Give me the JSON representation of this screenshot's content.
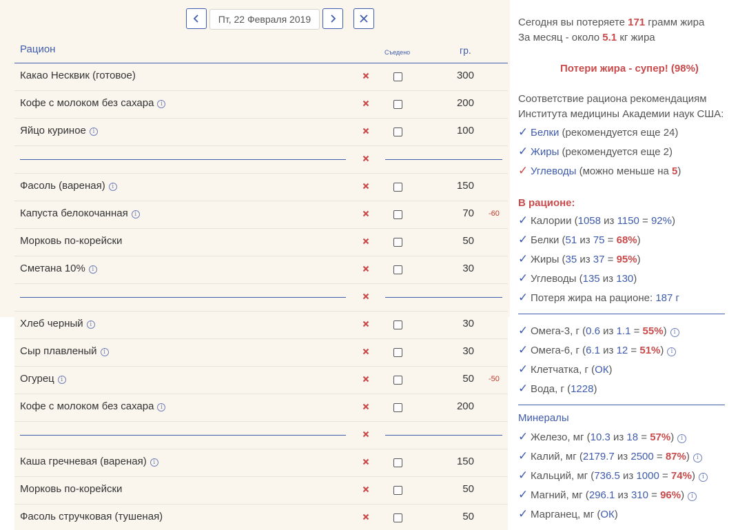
{
  "date_nav": {
    "date_text": "Пт, 22  Февраля 2019"
  },
  "table": {
    "title": "Рацион",
    "eaten_label": "Съедено",
    "unit_label": "гр.",
    "rows": [
      {
        "type": "item",
        "name": "Какао Несквик (готовое)",
        "info": false,
        "amount": "300",
        "diff": ""
      },
      {
        "type": "item",
        "name": "Кофе с молоком без сахара",
        "info": true,
        "amount": "200",
        "diff": ""
      },
      {
        "type": "item",
        "name": "Яйцо куриное",
        "info": true,
        "amount": "100",
        "diff": ""
      },
      {
        "type": "separator"
      },
      {
        "type": "item",
        "name": "Фасоль (вареная)",
        "info": true,
        "amount": "150",
        "diff": ""
      },
      {
        "type": "item",
        "name": "Капуста белокочанная",
        "info": true,
        "amount": "70",
        "diff": "-60"
      },
      {
        "type": "item",
        "name": "Морковь по-корейски",
        "info": false,
        "amount": "50",
        "diff": ""
      },
      {
        "type": "item",
        "name": "Сметана 10%",
        "info": true,
        "amount": "30",
        "diff": ""
      },
      {
        "type": "separator"
      },
      {
        "type": "item",
        "name": "Хлеб черный",
        "info": true,
        "amount": "30",
        "diff": ""
      },
      {
        "type": "item",
        "name": "Сыр плавленый",
        "info": true,
        "amount": "30",
        "diff": ""
      },
      {
        "type": "item",
        "name": "Огурец",
        "info": true,
        "amount": "50",
        "diff": "-50"
      },
      {
        "type": "item",
        "name": "Кофе с молоком без сахара",
        "info": true,
        "amount": "200",
        "diff": ""
      },
      {
        "type": "separator"
      },
      {
        "type": "item",
        "name": "Каша гречневая (вареная)",
        "info": true,
        "amount": "150",
        "diff": ""
      },
      {
        "type": "item",
        "name": "Морковь по-корейски",
        "info": false,
        "amount": "50",
        "diff": ""
      },
      {
        "type": "item",
        "name": "Фасоль стручковая (тушеная)",
        "info": false,
        "amount": "50",
        "diff": ""
      }
    ]
  },
  "summary": {
    "today_pre": "Сегодня вы потеряете ",
    "today_value": "171",
    "today_post": " грамм жира",
    "month_pre": "За месяц - около ",
    "month_value": "5.1",
    "month_post": " кг жира",
    "fat_loss_status": "Потери жира - супер! (98%)",
    "compliance_line1": "Соответствие рациона рекомендациям",
    "compliance_line2": "Института медицины Академии наук США:",
    "recommendations": [
      {
        "name": "Белки",
        "pre": " (рекомендуется еще ",
        "value": "24",
        "post": ")",
        "mark": "blue",
        "value_red": false
      },
      {
        "name": "Жиры",
        "pre": " (рекомендуется еще ",
        "value": "2",
        "post": ")",
        "mark": "blue",
        "value_red": false
      },
      {
        "name": "Углеводы",
        "pre": " (можно меньше на ",
        "value": "5",
        "post": ")",
        "mark": "red",
        "value_red": true
      }
    ],
    "in_diet_title": "В рационе:",
    "in_diet": [
      {
        "label": "Калории (",
        "a": "1058",
        "mid": " из ",
        "b": "1150",
        "eq": " = ",
        "pct": "92%",
        "pct_red": false,
        "end": ")"
      },
      {
        "label": "Белки (",
        "a": "51",
        "mid": " из ",
        "b": "75",
        "eq": " = ",
        "pct": "68%",
        "pct_red": true,
        "end": ")"
      },
      {
        "label": "Жиры (",
        "a": "35",
        "mid": " из ",
        "b": "37",
        "eq": " = ",
        "pct": "95%",
        "pct_red": true,
        "end": ")"
      },
      {
        "label": "Углеводы (",
        "a": "135",
        "mid": " из ",
        "b": "130",
        "eq": "",
        "pct": "",
        "pct_red": false,
        "end": ")"
      }
    ],
    "fat_loss_line_label": "Потеря жира на рационе: ",
    "fat_loss_line_value": "187 г",
    "omega": [
      {
        "label": "Омега-3, г (",
        "a": "0.6",
        "mid": " из ",
        "b": "1.1",
        "eq": " = ",
        "pct": "55%",
        "end": ")",
        "info": true
      },
      {
        "label": "Омега-6, г (",
        "a": "6.1",
        "mid": " из ",
        "b": "12",
        "eq": " = ",
        "pct": "51%",
        "end": ")",
        "info": true
      }
    ],
    "fiber_label": "Клетчатка, г (",
    "fiber_value": "ОК",
    "fiber_end": ")",
    "water_label": "Вода, г (",
    "water_value": "1228",
    "water_end": ")",
    "minerals_title": "Минералы",
    "minerals": [
      {
        "label": "Железо, мг (",
        "a": "10.3",
        "mid": " из ",
        "b": "18",
        "eq": " = ",
        "pct": "57%",
        "end": ")",
        "info": true
      },
      {
        "label": "Калий, мг (",
        "a": "2179.7",
        "mid": " из ",
        "b": "2500",
        "eq": " = ",
        "pct": "87%",
        "end": ")",
        "info": true
      },
      {
        "label": "Кальций, мг (",
        "a": "736.5",
        "mid": " из ",
        "b": "1000",
        "eq": " = ",
        "pct": "74%",
        "end": ")",
        "info": true
      },
      {
        "label": "Магний, мг (",
        "a": "296.1",
        "mid": " из ",
        "b": "310",
        "eq": " = ",
        "pct": "96%",
        "end": ")",
        "info": true
      }
    ],
    "manganese_label": "Марганец, мг (",
    "manganese_value": "ОК",
    "manganese_end": ")"
  },
  "colors": {
    "accent": "#3f5bab",
    "danger": "#c84a4a",
    "panel_bg": "#faf6ee"
  }
}
